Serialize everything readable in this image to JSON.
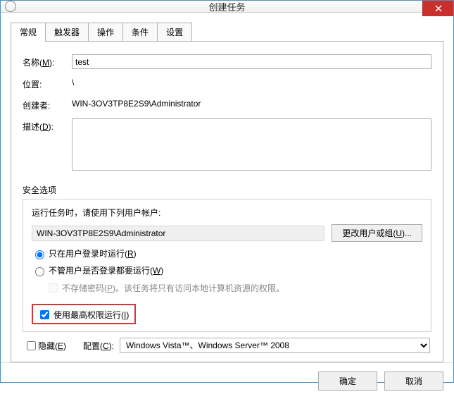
{
  "window": {
    "title": "创建任务"
  },
  "tabs": {
    "t0": "常规",
    "t1": "触发器",
    "t2": "操作",
    "t3": "条件",
    "t4": "设置"
  },
  "fields": {
    "nameLabel": "名称(M):",
    "nameValue": "test",
    "locationLabel": "位置:",
    "locationValue": "\\",
    "creatorLabel": "创建者:",
    "creatorValue": "WIN-3OV3TP8E2S9\\Administrator",
    "descLabel": "描述(D):",
    "descValue": ""
  },
  "security": {
    "legend": "安全选项",
    "accountHint": "运行任务时，请使用下列用户帐户:",
    "accountValue": "WIN-3OV3TP8E2S9\\Administrator",
    "changeUserBtn": "更改用户或组(U)...",
    "radio1": "只在用户登录时运行(R)",
    "radio2": "不管用户是否登录都要运行(W)",
    "noPassword": "不存储密码(P)。该任务将只有访问本地计算机资源的权限。",
    "highestPriv": "使用最高权限运行(I)"
  },
  "bottom": {
    "hidden": "隐藏(E)",
    "configLabel": "配置(C):",
    "configValue": "Windows Vista™、Windows Server™ 2008"
  },
  "footer": {
    "ok": "确定",
    "cancel": "取消"
  }
}
